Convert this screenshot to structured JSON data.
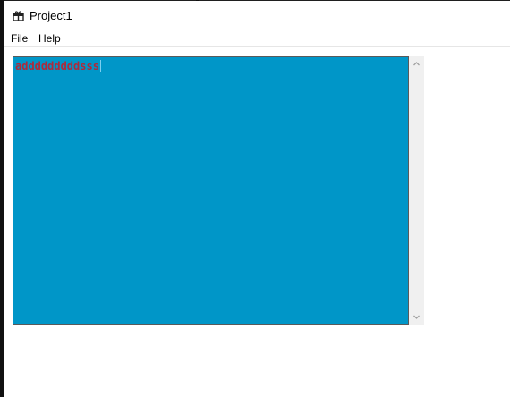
{
  "window": {
    "title": "Project1",
    "icon": "app-icon"
  },
  "menu": {
    "items": [
      {
        "label": "File"
      },
      {
        "label": "Help"
      }
    ]
  },
  "editor": {
    "text": "adddddddddsss",
    "background_color": "#0096c8",
    "text_color": "#b0293a"
  },
  "scrollbar": {
    "up_icon": "chevron-up-icon",
    "down_icon": "chevron-down-icon"
  }
}
